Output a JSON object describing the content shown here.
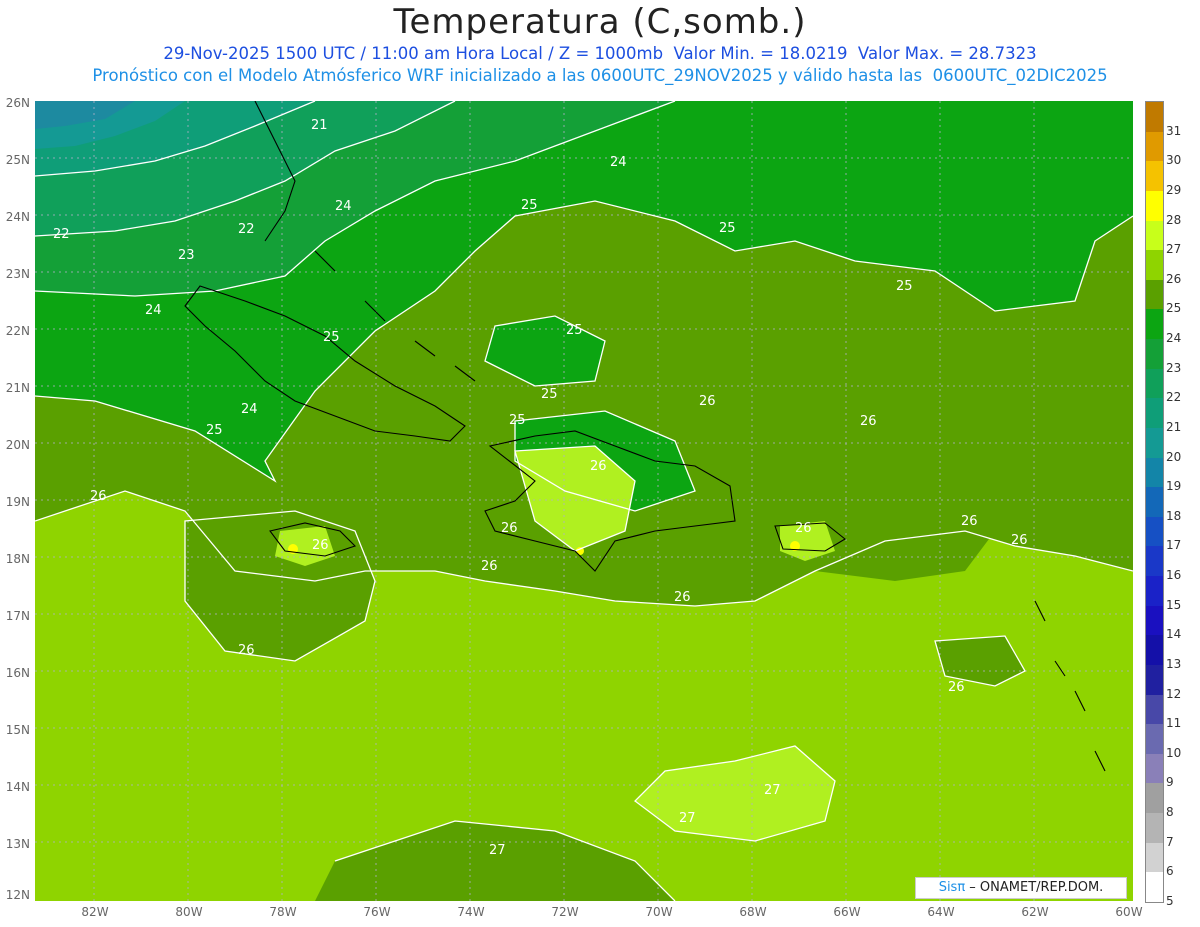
{
  "header": {
    "title": "Temperatura (C,somb.)",
    "line1": "29-Nov-2025 1500 UTC / 11:00 am Hora Local / Z = 1000mb  Valor Min. = 18.0219  Valor Max. = 28.7323",
    "line2": "Pronóstico con el Modelo Atmósferico WRF inicializado a las 0600UTC_29NOV2025 y válido hasta las  0600UTC_02DIC2025"
  },
  "axes": {
    "lat_labels": [
      "26N",
      "25N",
      "24N",
      "23N",
      "22N",
      "21N",
      "20N",
      "19N",
      "18N",
      "17N",
      "16N",
      "15N",
      "14N",
      "13N",
      "12N"
    ],
    "lon_labels": [
      "82W",
      "80W",
      "78W",
      "76W",
      "74W",
      "72W",
      "70W",
      "68W",
      "66W",
      "64W",
      "62W",
      "60W"
    ]
  },
  "colorbar": {
    "labels": [
      "31",
      "30",
      "29",
      "28",
      "27",
      "26",
      "25",
      "24",
      "23",
      "22",
      "21",
      "20",
      "19",
      "18",
      "17",
      "16",
      "15",
      "14",
      "13",
      "12",
      "11",
      "10",
      "9",
      "8",
      "7",
      "6",
      "5"
    ],
    "colors": [
      "#c07a00",
      "#e09a00",
      "#f5c200",
      "#ffff00",
      "#c8ff1a",
      "#8fd400",
      "#5aa000",
      "#0ca512",
      "#14a037",
      "#10a05a",
      "#0f9e78",
      "#149a94",
      "#1385a8",
      "#1368b8",
      "#1650c4",
      "#1a38c8",
      "#1a22c8",
      "#1a10c0",
      "#1410a8",
      "#2020a0",
      "#4848a8",
      "#6a6ab0",
      "#8a80b8",
      "#a0a0a0",
      "#b4b4b4",
      "#d2d2d2",
      "#ffffff"
    ]
  },
  "contour_labels": [
    "21",
    "22",
    "22",
    "23",
    "24",
    "24",
    "24",
    "24",
    "25",
    "25",
    "25",
    "25",
    "25",
    "25",
    "25",
    "25",
    "26",
    "26",
    "26",
    "26",
    "26",
    "26",
    "26",
    "26",
    "26",
    "26",
    "26",
    "26",
    "26",
    "27",
    "27",
    "27"
  ],
  "credit": {
    "brand": "Sisπ",
    "text": " – ONAMET/REP.DOM."
  }
}
